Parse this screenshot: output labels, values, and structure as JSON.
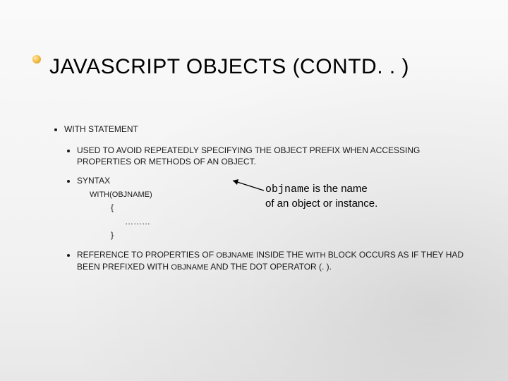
{
  "title": "JAVASCRIPT OBJECTS (CONTD. . )",
  "lvl1": {
    "with_statement": "WITH STATEMENT"
  },
  "lvl2": {
    "used_to": "USED TO AVOID REPEATEDLY SPECIFYING THE OBJECT PREFIX WHEN ACCESSING PROPERTIES OR METHODS OF AN OBJECT.",
    "syntax": "SYNTAX",
    "reference_pre": "REFERENCE TO PROPERTIES OF ",
    "reference_mid": " INSIDE THE ",
    "reference_mid2": " BLOCK OCCURS AS IF THEY HAD BEEN PREFIXED WITH ",
    "reference_end": " AND THE DOT OPERATOR (. )."
  },
  "code_words": {
    "objname_upper": "OBJNAME",
    "with_upper": "WITH"
  },
  "syntax_code": {
    "line1": "WITH(OBJNAME)",
    "open": "{",
    "dots": "………",
    "close": "}"
  },
  "callout": {
    "objname": "objname",
    "rest1": " is the name",
    "line2": "of an object or instance."
  }
}
